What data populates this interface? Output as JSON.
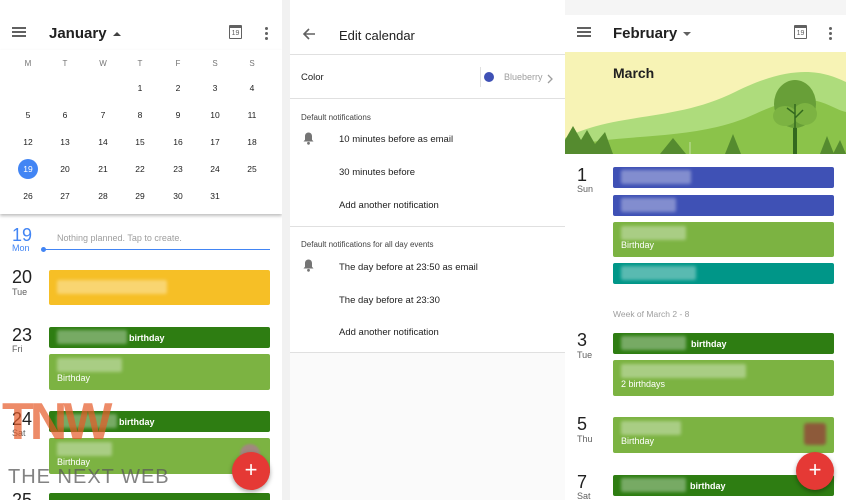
{
  "left_panel": {
    "month_title": "January",
    "calendar_icon_label": "19",
    "weekdays": [
      "M",
      "T",
      "W",
      "T",
      "F",
      "S",
      "S"
    ],
    "weeks": [
      [
        "",
        "",
        "",
        "1",
        "2",
        "3",
        "4"
      ],
      [
        "5",
        "6",
        "7",
        "8",
        "9",
        "10",
        "11"
      ],
      [
        "12",
        "13",
        "14",
        "15",
        "16",
        "17",
        "18"
      ],
      [
        "19",
        "20",
        "21",
        "22",
        "23",
        "24",
        "25"
      ],
      [
        "26",
        "27",
        "28",
        "29",
        "30",
        "31",
        ""
      ]
    ],
    "selected_day": "19",
    "agenda": [
      {
        "num": "19",
        "name": "Mon",
        "empty_text": "Nothing planned. Tap to create."
      },
      {
        "num": "20",
        "name": "Tue"
      },
      {
        "num": "23",
        "name": "Fri",
        "events": [
          "birthday",
          "Birthday"
        ]
      },
      {
        "num": "24",
        "name": "Sat",
        "events": [
          "birthday",
          "Birthday"
        ]
      },
      {
        "num": "25",
        "name": ""
      }
    ],
    "fab_label": "+"
  },
  "middle_panel": {
    "title": "Edit calendar",
    "color_label": "Color",
    "color_value": "Blueberry",
    "color_swatch": "#3f51b5",
    "section1_title": "Default notifications",
    "section1_items": [
      "10 minutes before as email",
      "30 minutes before",
      "Add another notification"
    ],
    "section2_title": "Default notifications for all day events",
    "section2_items": [
      "The day before at 23:50 as email",
      "The day before at 23:30",
      "Add another notification"
    ]
  },
  "right_panel": {
    "month_title": "February",
    "calendar_icon_label": "19",
    "banner_title": "March",
    "days": [
      {
        "num": "1",
        "name": "Sun",
        "events": [
          "",
          "",
          "Birthday",
          ""
        ]
      },
      {
        "num": "3",
        "name": "Tue",
        "events": [
          "birthday",
          "2 birthdays"
        ]
      },
      {
        "num": "5",
        "name": "Thu",
        "events": [
          "Birthday"
        ]
      },
      {
        "num": "7",
        "name": "Sat",
        "events": [
          "birthday"
        ]
      }
    ],
    "week_label": "Week of March 2 - 8",
    "fab_label": "+"
  },
  "watermark": {
    "logo_letters": "TNW",
    "text": "THE NEXT WEB"
  },
  "colors": {
    "blue_accent": "#4285f4",
    "yellow_event": "#f6bf26",
    "dark_green_event": "#2e7d12",
    "light_green_event": "#7cb342",
    "blueberry_event": "#3f51b5",
    "teal_event": "#009688",
    "fab_red": "#e53935"
  }
}
